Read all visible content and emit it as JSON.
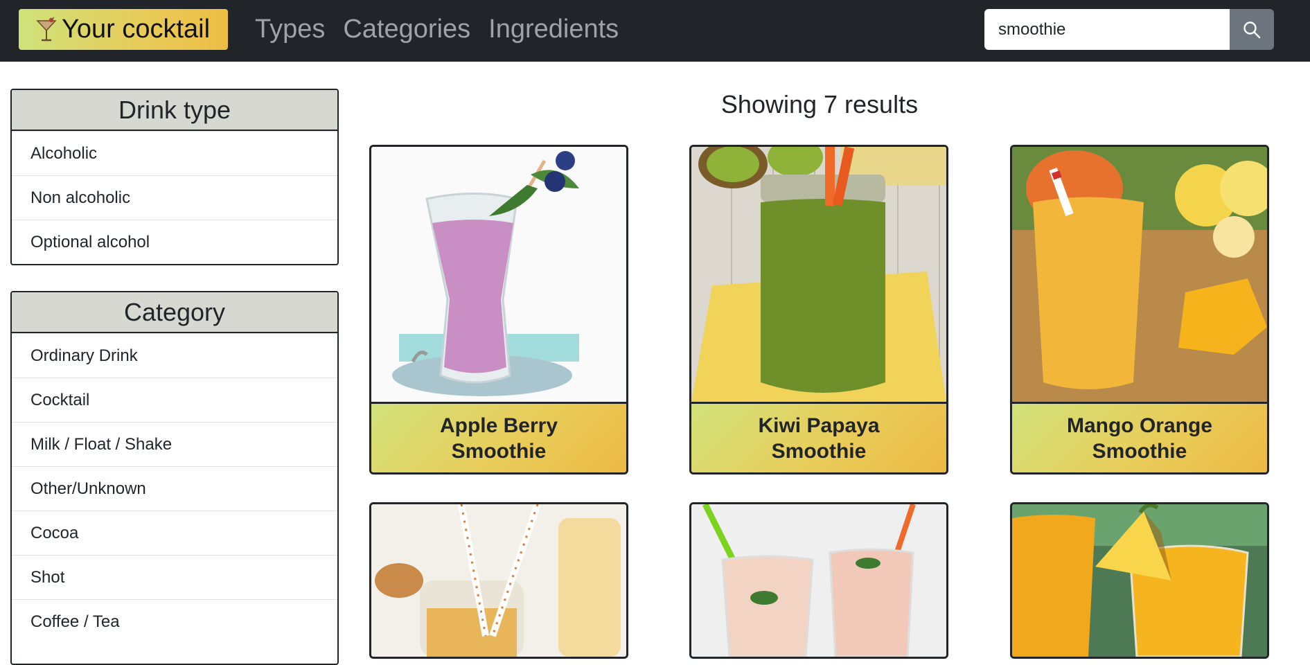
{
  "navbar": {
    "brand": "Your cocktail",
    "links": [
      "Types",
      "Categories",
      "Ingredients"
    ],
    "search_value": "smoothie",
    "search_icon": "search-icon",
    "brand_icon": "cocktail-glass-icon"
  },
  "sidebar": {
    "drink_type": {
      "title": "Drink type",
      "items": [
        "Alcoholic",
        "Non alcoholic",
        "Optional alcohol"
      ]
    },
    "category": {
      "title": "Category",
      "items": [
        "Ordinary Drink",
        "Cocktail",
        "Milk / Float / Shake",
        "Other/Unknown",
        "Cocoa",
        "Shot",
        "Coffee / Tea"
      ]
    }
  },
  "results": {
    "heading": "Showing 7 results",
    "cards": [
      {
        "title": "Apple Berry Smoothie"
      },
      {
        "title": "Kiwi Papaya Smoothie"
      },
      {
        "title": "Mango Orange Smoothie"
      },
      {
        "title": ""
      },
      {
        "title": ""
      },
      {
        "title": ""
      }
    ]
  },
  "colors": {
    "navbar_bg": "#212529",
    "brand_gradient_start": "#cfe27a",
    "brand_gradient_end": "#ecbd45",
    "panel_header_bg": "#d8d8d3",
    "search_button_bg": "#6c757d"
  }
}
